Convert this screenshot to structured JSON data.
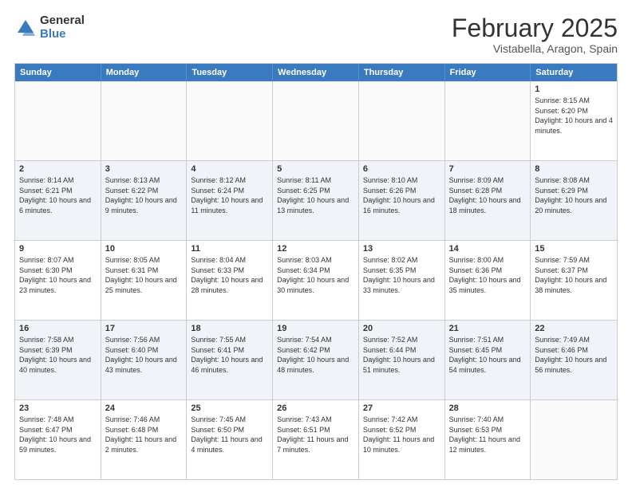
{
  "header": {
    "logo_general": "General",
    "logo_blue": "Blue",
    "title": "February 2025",
    "subtitle": "Vistabella, Aragon, Spain"
  },
  "days_of_week": [
    "Sunday",
    "Monday",
    "Tuesday",
    "Wednesday",
    "Thursday",
    "Friday",
    "Saturday"
  ],
  "weeks": [
    {
      "even": false,
      "days": [
        {
          "num": "",
          "info": ""
        },
        {
          "num": "",
          "info": ""
        },
        {
          "num": "",
          "info": ""
        },
        {
          "num": "",
          "info": ""
        },
        {
          "num": "",
          "info": ""
        },
        {
          "num": "",
          "info": ""
        },
        {
          "num": "1",
          "info": "Sunrise: 8:15 AM\nSunset: 6:20 PM\nDaylight: 10 hours and 4 minutes."
        }
      ]
    },
    {
      "even": true,
      "days": [
        {
          "num": "2",
          "info": "Sunrise: 8:14 AM\nSunset: 6:21 PM\nDaylight: 10 hours and 6 minutes."
        },
        {
          "num": "3",
          "info": "Sunrise: 8:13 AM\nSunset: 6:22 PM\nDaylight: 10 hours and 9 minutes."
        },
        {
          "num": "4",
          "info": "Sunrise: 8:12 AM\nSunset: 6:24 PM\nDaylight: 10 hours and 11 minutes."
        },
        {
          "num": "5",
          "info": "Sunrise: 8:11 AM\nSunset: 6:25 PM\nDaylight: 10 hours and 13 minutes."
        },
        {
          "num": "6",
          "info": "Sunrise: 8:10 AM\nSunset: 6:26 PM\nDaylight: 10 hours and 16 minutes."
        },
        {
          "num": "7",
          "info": "Sunrise: 8:09 AM\nSunset: 6:28 PM\nDaylight: 10 hours and 18 minutes."
        },
        {
          "num": "8",
          "info": "Sunrise: 8:08 AM\nSunset: 6:29 PM\nDaylight: 10 hours and 20 minutes."
        }
      ]
    },
    {
      "even": false,
      "days": [
        {
          "num": "9",
          "info": "Sunrise: 8:07 AM\nSunset: 6:30 PM\nDaylight: 10 hours and 23 minutes."
        },
        {
          "num": "10",
          "info": "Sunrise: 8:05 AM\nSunset: 6:31 PM\nDaylight: 10 hours and 25 minutes."
        },
        {
          "num": "11",
          "info": "Sunrise: 8:04 AM\nSunset: 6:33 PM\nDaylight: 10 hours and 28 minutes."
        },
        {
          "num": "12",
          "info": "Sunrise: 8:03 AM\nSunset: 6:34 PM\nDaylight: 10 hours and 30 minutes."
        },
        {
          "num": "13",
          "info": "Sunrise: 8:02 AM\nSunset: 6:35 PM\nDaylight: 10 hours and 33 minutes."
        },
        {
          "num": "14",
          "info": "Sunrise: 8:00 AM\nSunset: 6:36 PM\nDaylight: 10 hours and 35 minutes."
        },
        {
          "num": "15",
          "info": "Sunrise: 7:59 AM\nSunset: 6:37 PM\nDaylight: 10 hours and 38 minutes."
        }
      ]
    },
    {
      "even": true,
      "days": [
        {
          "num": "16",
          "info": "Sunrise: 7:58 AM\nSunset: 6:39 PM\nDaylight: 10 hours and 40 minutes."
        },
        {
          "num": "17",
          "info": "Sunrise: 7:56 AM\nSunset: 6:40 PM\nDaylight: 10 hours and 43 minutes."
        },
        {
          "num": "18",
          "info": "Sunrise: 7:55 AM\nSunset: 6:41 PM\nDaylight: 10 hours and 46 minutes."
        },
        {
          "num": "19",
          "info": "Sunrise: 7:54 AM\nSunset: 6:42 PM\nDaylight: 10 hours and 48 minutes."
        },
        {
          "num": "20",
          "info": "Sunrise: 7:52 AM\nSunset: 6:44 PM\nDaylight: 10 hours and 51 minutes."
        },
        {
          "num": "21",
          "info": "Sunrise: 7:51 AM\nSunset: 6:45 PM\nDaylight: 10 hours and 54 minutes."
        },
        {
          "num": "22",
          "info": "Sunrise: 7:49 AM\nSunset: 6:46 PM\nDaylight: 10 hours and 56 minutes."
        }
      ]
    },
    {
      "even": false,
      "days": [
        {
          "num": "23",
          "info": "Sunrise: 7:48 AM\nSunset: 6:47 PM\nDaylight: 10 hours and 59 minutes."
        },
        {
          "num": "24",
          "info": "Sunrise: 7:46 AM\nSunset: 6:48 PM\nDaylight: 11 hours and 2 minutes."
        },
        {
          "num": "25",
          "info": "Sunrise: 7:45 AM\nSunset: 6:50 PM\nDaylight: 11 hours and 4 minutes."
        },
        {
          "num": "26",
          "info": "Sunrise: 7:43 AM\nSunset: 6:51 PM\nDaylight: 11 hours and 7 minutes."
        },
        {
          "num": "27",
          "info": "Sunrise: 7:42 AM\nSunset: 6:52 PM\nDaylight: 11 hours and 10 minutes."
        },
        {
          "num": "28",
          "info": "Sunrise: 7:40 AM\nSunset: 6:53 PM\nDaylight: 11 hours and 12 minutes."
        },
        {
          "num": "",
          "info": ""
        }
      ]
    }
  ]
}
